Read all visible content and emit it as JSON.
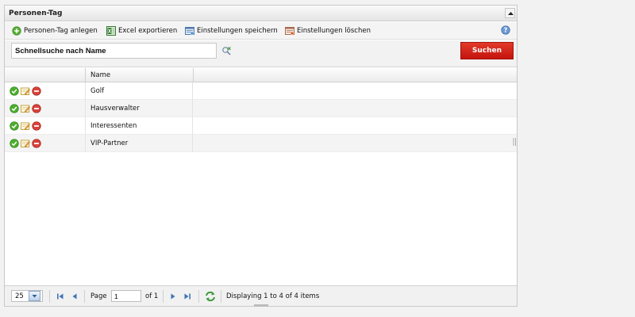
{
  "panel": {
    "title": "Personen-Tag"
  },
  "toolbar": {
    "add_label": "Personen-Tag anlegen",
    "excel_label": "Excel exportieren",
    "save_settings_label": "Einstellungen speichern",
    "delete_settings_label": "Einstellungen löschen"
  },
  "search": {
    "placeholder": "Schnellsuche nach Name",
    "value": "",
    "button_label": "Suchen"
  },
  "grid": {
    "columns": [
      "",
      "Name"
    ],
    "rows": [
      {
        "name": "Golf"
      },
      {
        "name": "Hausverwalter"
      },
      {
        "name": "Interessenten"
      },
      {
        "name": "VIP-Partner"
      }
    ]
  },
  "pager": {
    "page_size": "25",
    "page_label": "Page",
    "current_page": "1",
    "of_label": "of 1",
    "display_text": "Displaying 1 to 4 of 4 items"
  },
  "colors": {
    "search_button": "#d0211a",
    "ok": "#4caf2d",
    "delete": "#d9433b"
  }
}
